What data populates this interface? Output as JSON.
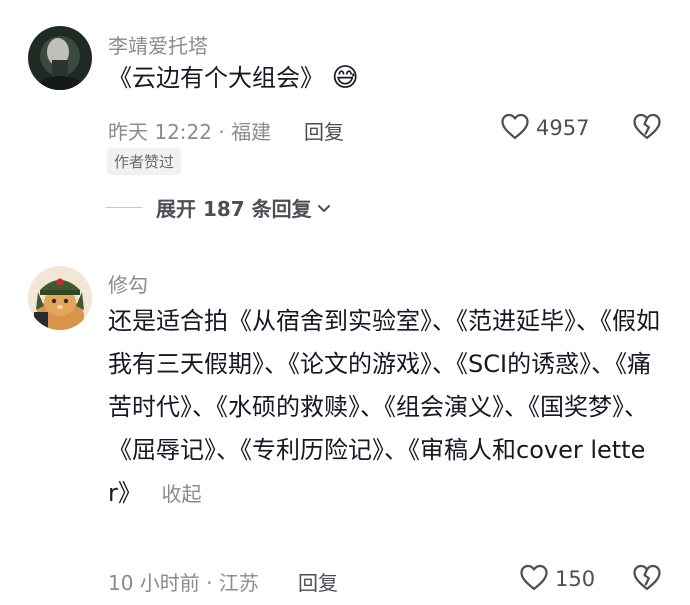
{
  "comments": [
    {
      "username": "李靖爱托塔",
      "text": "《云边有个大组会》",
      "emoji": "😅",
      "time_location": "昨天 12:22 · 福建",
      "reply_label": "回复",
      "like_count": "4957",
      "badge": "作者赞过",
      "expand_label": "展开 187 条回复"
    },
    {
      "username": "修勾",
      "text": "还是适合拍《从宿舍到实验室》、《范进延毕》、《假如我有三天假期》、《论文的游戏》、《SCI的诱惑》、《痛苦时代》、《水硕的救赎》、《组会演义》、《国奖梦》、《屈辱记》、《专利历险记》、《审稿人和cover letter》",
      "collapse_label": "收起",
      "time_location": "10 小时前 · 江苏",
      "reply_label": "回复",
      "like_count": "150"
    }
  ]
}
